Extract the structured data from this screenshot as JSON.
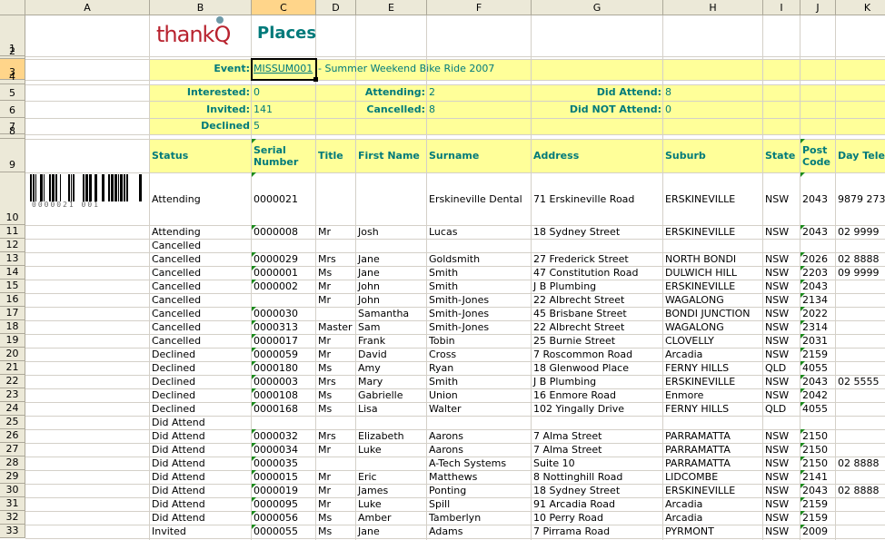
{
  "columns": [
    "A",
    "B",
    "C",
    "D",
    "E",
    "F",
    "G",
    "H",
    "I",
    "J",
    "K"
  ],
  "selected_column": "C",
  "selected_row": "3",
  "header": {
    "logo": "thankQ",
    "title": "Places"
  },
  "event": {
    "label": "Event:",
    "code": "MISSUM001",
    "name": "- Summer Weekend Bike Ride 2007"
  },
  "summary": {
    "interested_label": "Interested:",
    "interested": "0",
    "invited_label": "Invited:",
    "invited": "141",
    "declined_label": "Declined",
    "declined": "5",
    "attending_label": "Attending:",
    "attending": "2",
    "cancelled_label": "Cancelled:",
    "cancelled": "8",
    "did_attend_label": "Did Attend:",
    "did_attend": "8",
    "did_not_attend_label": "Did NOT Attend:",
    "did_not_attend": "0"
  },
  "table_headers": {
    "status": "Status",
    "serial": "Serial Number",
    "title": "Title",
    "first": "First Name",
    "surname": "Surname",
    "address": "Address",
    "suburb": "Suburb",
    "state": "State",
    "postcode": "Post Code",
    "day_tel": "Day Tele"
  },
  "barcode_text": "0000021 001",
  "rows": [
    {
      "r": "10",
      "status": "Attending",
      "serial": "0000021",
      "title": "",
      "first": "",
      "surname": "Erskineville Dental",
      "address": "71 Erskineville Road",
      "suburb": "ERSKINEVILLE",
      "state": "NSW",
      "postcode": "2043",
      "tel": "9879 273"
    },
    {
      "r": "11",
      "status": "Attending",
      "serial": "0000008",
      "title": "Mr",
      "first": "Josh",
      "surname": "Lucas",
      "address": "18 Sydney Street",
      "suburb": "ERSKINEVILLE",
      "state": "NSW",
      "postcode": "2043",
      "tel": "02 9999"
    },
    {
      "r": "12",
      "status": "Cancelled",
      "serial": "",
      "title": "",
      "first": "",
      "surname": "",
      "address": "",
      "suburb": "",
      "state": "",
      "postcode": "",
      "tel": ""
    },
    {
      "r": "13",
      "status": "Cancelled",
      "serial": "0000029",
      "title": "Mrs",
      "first": "Jane",
      "surname": "Goldsmith",
      "address": "27 Frederick Street",
      "suburb": "NORTH BONDI",
      "state": "NSW",
      "postcode": "2026",
      "tel": "02 8888"
    },
    {
      "r": "14",
      "status": "Cancelled",
      "serial": "0000001",
      "title": "Ms",
      "first": "Jane",
      "surname": "Smith",
      "address": "47 Constitution Road",
      "suburb": "DULWICH HILL",
      "state": "NSW",
      "postcode": "2203",
      "tel": "09 9999"
    },
    {
      "r": "15",
      "status": "Cancelled",
      "serial": "0000002",
      "title": "Mr",
      "first": "John",
      "surname": "Smith",
      "address": "J B Plumbing",
      "suburb": "ERSKINEVILLE",
      "state": "NSW",
      "postcode": "2043",
      "tel": ""
    },
    {
      "r": "16",
      "status": "Cancelled",
      "serial": "",
      "title": "Mr",
      "first": "John",
      "surname": "Smith-Jones",
      "address": "22 Albrecht Street",
      "suburb": "WAGALONG",
      "state": "NSW",
      "postcode": "2134",
      "tel": ""
    },
    {
      "r": "17",
      "status": "Cancelled",
      "serial": "0000030",
      "title": "",
      "first": "Samantha",
      "surname": "Smith-Jones",
      "address": "45 Brisbane Street",
      "suburb": "BONDI JUNCTION",
      "state": "NSW",
      "postcode": "2022",
      "tel": ""
    },
    {
      "r": "18",
      "status": "Cancelled",
      "serial": "0000313",
      "title": "Master",
      "first": "Sam",
      "surname": "Smith-Jones",
      "address": "22 Albrecht Street",
      "suburb": "WAGALONG",
      "state": "NSW",
      "postcode": "2314",
      "tel": ""
    },
    {
      "r": "19",
      "status": "Cancelled",
      "serial": "0000017",
      "title": "Mr",
      "first": "Frank",
      "surname": "Tobin",
      "address": "25 Burnie Street",
      "suburb": "CLOVELLY",
      "state": "NSW",
      "postcode": "2031",
      "tel": ""
    },
    {
      "r": "20",
      "status": "Declined",
      "serial": "0000059",
      "title": "Mr",
      "first": "David",
      "surname": "Cross",
      "address": "7 Roscommon Road",
      "suburb": "Arcadia",
      "state": "NSW",
      "postcode": "2159",
      "tel": ""
    },
    {
      "r": "21",
      "status": "Declined",
      "serial": "0000180",
      "title": "Ms",
      "first": "Amy",
      "surname": "Ryan",
      "address": "18 Glenwood Place",
      "suburb": "FERNY HILLS",
      "state": "QLD",
      "postcode": "4055",
      "tel": ""
    },
    {
      "r": "22",
      "status": "Declined",
      "serial": "0000003",
      "title": "Mrs",
      "first": "Mary",
      "surname": "Smith",
      "address": "J B Plumbing",
      "suburb": "ERSKINEVILLE",
      "state": "NSW",
      "postcode": "2043",
      "tel": "02 5555"
    },
    {
      "r": "23",
      "status": "Declined",
      "serial": "0000108",
      "title": "Ms",
      "first": "Gabrielle",
      "surname": "Union",
      "address": "16 Enmore Road",
      "suburb": "Enmore",
      "state": "NSW",
      "postcode": "2042",
      "tel": ""
    },
    {
      "r": "24",
      "status": "Declined",
      "serial": "0000168",
      "title": "Ms",
      "first": "Lisa",
      "surname": "Walter",
      "address": "102 Yingally Drive",
      "suburb": "FERNY HILLS",
      "state": "QLD",
      "postcode": "4055",
      "tel": ""
    },
    {
      "r": "25",
      "status": "Did Attend",
      "serial": "",
      "title": "",
      "first": "",
      "surname": "",
      "address": "",
      "suburb": "",
      "state": "",
      "postcode": "",
      "tel": ""
    },
    {
      "r": "26",
      "status": "Did Attend",
      "serial": "0000032",
      "title": "Mrs",
      "first": "Elizabeth",
      "surname": "Aarons",
      "address": "7 Alma Street",
      "suburb": "PARRAMATTA",
      "state": "NSW",
      "postcode": "2150",
      "tel": ""
    },
    {
      "r": "27",
      "status": "Did Attend",
      "serial": "0000034",
      "title": "Mr",
      "first": "Luke",
      "surname": "Aarons",
      "address": "7 Alma Street",
      "suburb": "PARRAMATTA",
      "state": "NSW",
      "postcode": "2150",
      "tel": ""
    },
    {
      "r": "28",
      "status": "Did Attend",
      "serial": "0000035",
      "title": "",
      "first": "",
      "surname": "A-Tech Systems",
      "address": "Suite 10",
      "suburb": "PARRAMATTA",
      "state": "NSW",
      "postcode": "2150",
      "tel": "02 8888"
    },
    {
      "r": "29",
      "status": "Did Attend",
      "serial": "0000015",
      "title": "Mr",
      "first": "Eric",
      "surname": "Matthews",
      "address": "8 Nottinghill Road",
      "suburb": "LIDCOMBE",
      "state": "NSW",
      "postcode": "2141",
      "tel": ""
    },
    {
      "r": "30",
      "status": "Did Attend",
      "serial": "0000019",
      "title": "Mr",
      "first": "James",
      "surname": "Ponting",
      "address": "18 Sydney Street",
      "suburb": "ERSKINEVILLE",
      "state": "NSW",
      "postcode": "2043",
      "tel": "02 8888"
    },
    {
      "r": "31",
      "status": "Did Attend",
      "serial": "0000095",
      "title": "Mr",
      "first": "Luke",
      "surname": "Spill",
      "address": "91 Arcadia Road",
      "suburb": "Arcadia",
      "state": "NSW",
      "postcode": "2159",
      "tel": ""
    },
    {
      "r": "32",
      "status": "Did Attend",
      "serial": "0000056",
      "title": "Ms",
      "first": "Amber",
      "surname": "Tamberlyn",
      "address": "10 Perry Road",
      "suburb": "Arcadia",
      "state": "NSW",
      "postcode": "2159",
      "tel": ""
    },
    {
      "r": "33",
      "status": "Invited",
      "serial": "0000055",
      "title": "Ms",
      "first": "Jane",
      "surname": "Adams",
      "address": "7 Pirrama Road",
      "suburb": "PYRMONT",
      "state": "NSW",
      "postcode": "2009",
      "tel": ""
    }
  ]
}
